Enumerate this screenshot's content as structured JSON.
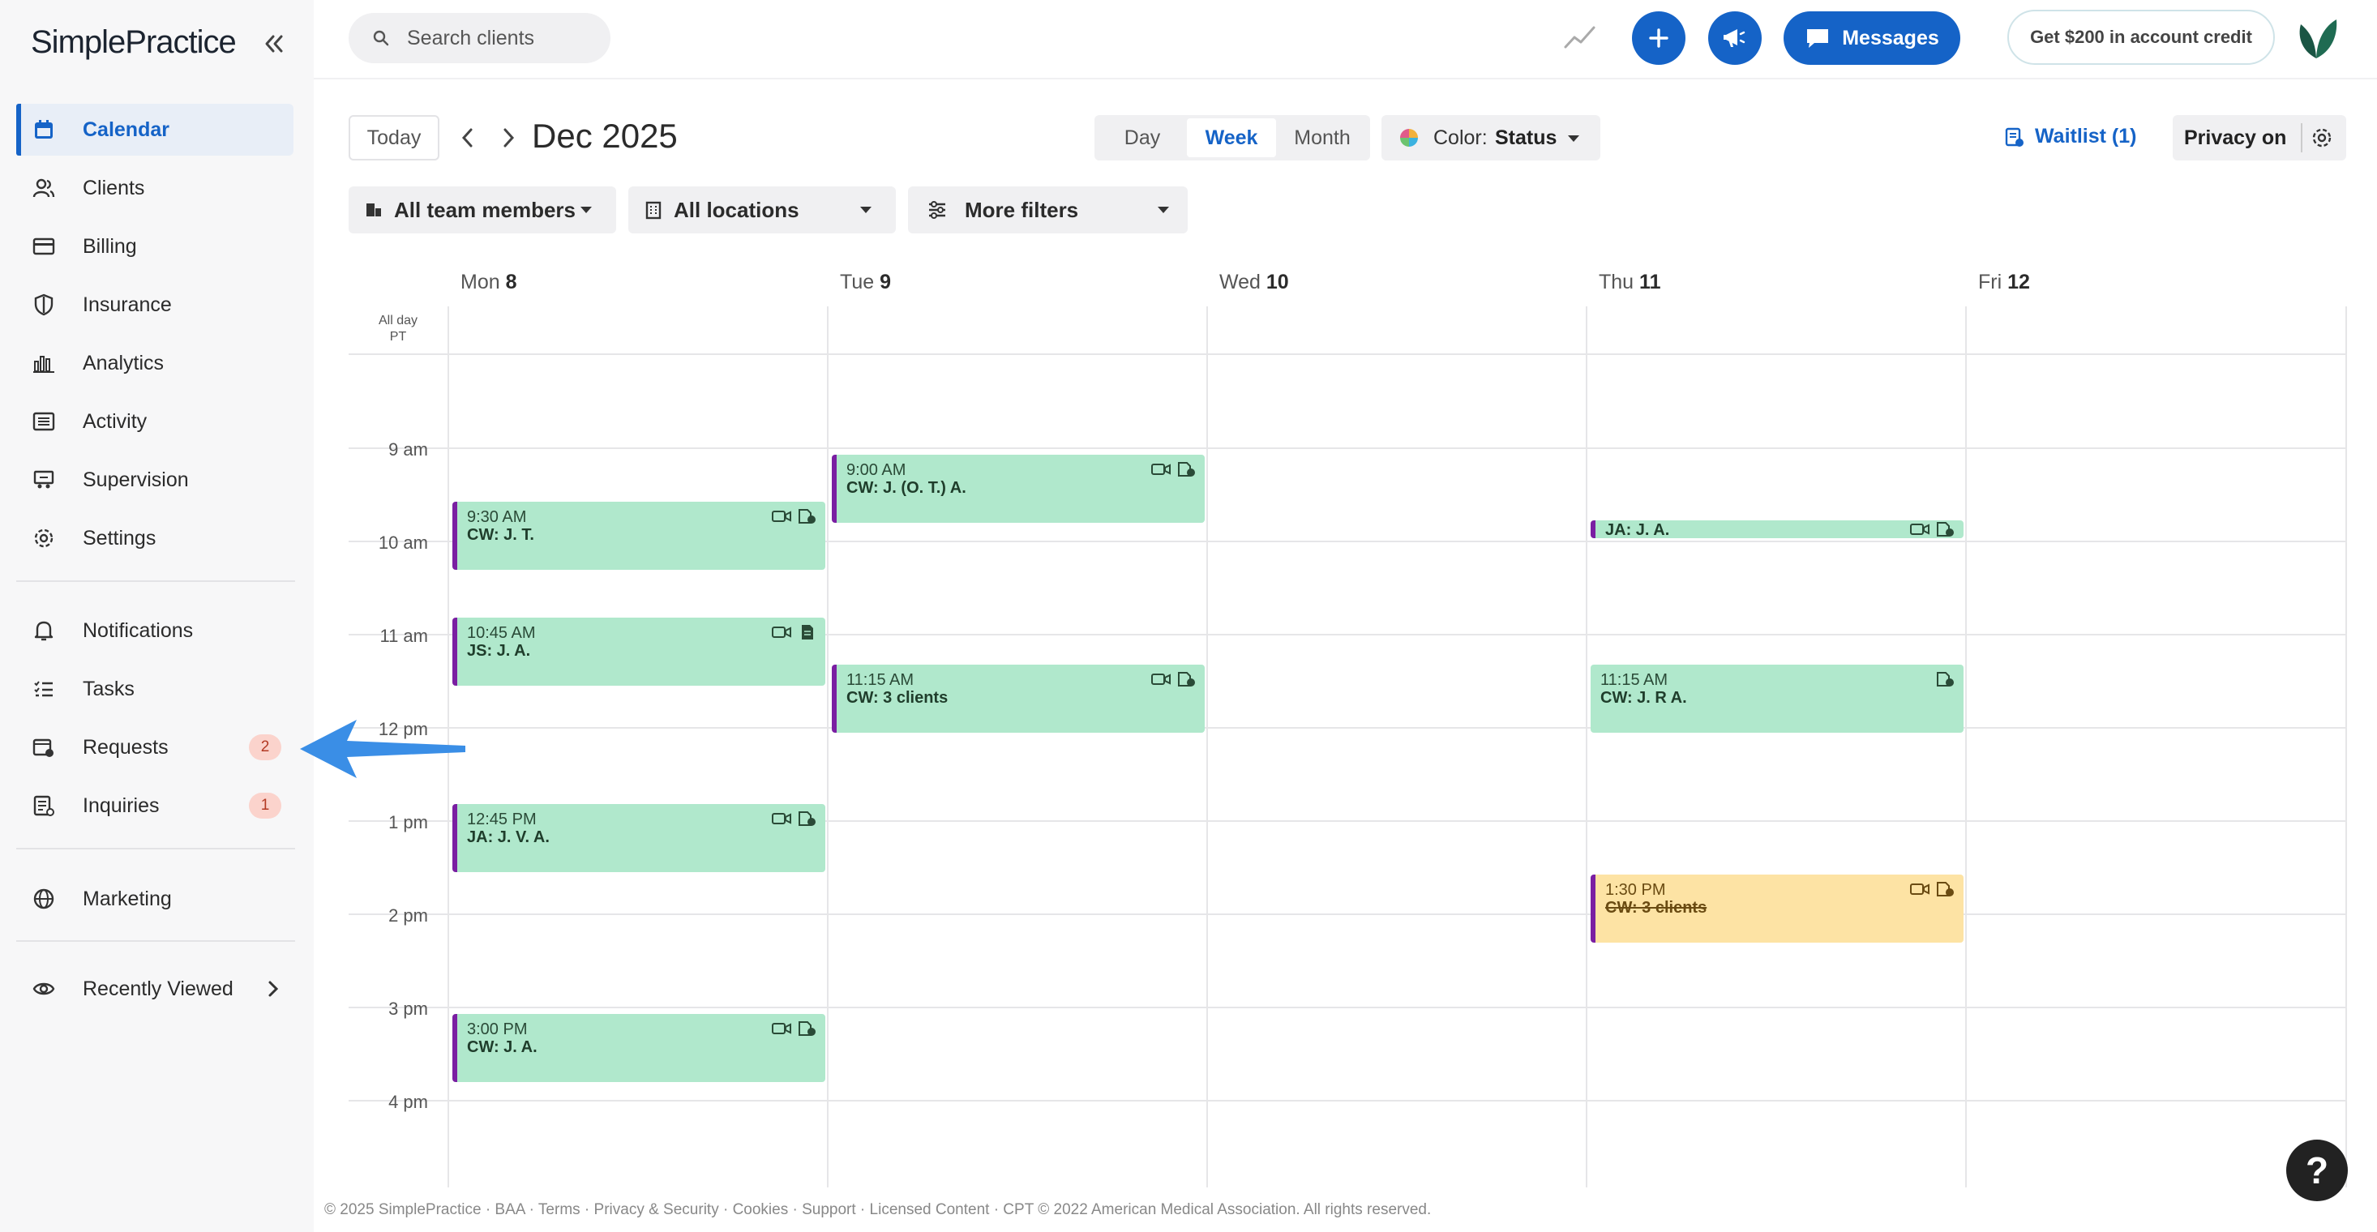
{
  "brand": {
    "name": "SimplePractice"
  },
  "sidebar": {
    "items": [
      {
        "label": "Calendar",
        "icon": "calendar-icon",
        "active": true
      },
      {
        "label": "Clients",
        "icon": "clients-icon"
      },
      {
        "label": "Billing",
        "icon": "billing-card-icon"
      },
      {
        "label": "Insurance",
        "icon": "shield-icon"
      },
      {
        "label": "Analytics",
        "icon": "bar-chart-icon"
      },
      {
        "label": "Activity",
        "icon": "activity-list-icon"
      },
      {
        "label": "Supervision",
        "icon": "supervision-icon"
      },
      {
        "label": "Settings",
        "icon": "gear-icon"
      },
      {
        "label": "Notifications",
        "icon": "bell-icon"
      },
      {
        "label": "Tasks",
        "icon": "tasks-icon"
      },
      {
        "label": "Requests",
        "icon": "requests-calendar-icon",
        "badge": "2"
      },
      {
        "label": "Inquiries",
        "icon": "inquiries-icon",
        "badge": "1"
      },
      {
        "label": "Marketing",
        "icon": "globe-icon"
      },
      {
        "label": "Recently Viewed",
        "icon": "eye-icon"
      }
    ]
  },
  "topbar": {
    "search_placeholder": "Search clients",
    "messages_label": "Messages",
    "credit_label": "Get $200 in account credit"
  },
  "toolbar": {
    "today_label": "Today",
    "month_title": "Dec 2025",
    "views": [
      "Day",
      "Week",
      "Month"
    ],
    "selected_view": "Week",
    "color_prefix": "Color:",
    "color_value": "Status",
    "waitlist_label": "Waitlist (1)",
    "privacy_label": "Privacy on"
  },
  "filters": {
    "team": "All team members",
    "locations": "All locations",
    "more": "More filters"
  },
  "calendar": {
    "allday_label": "All day",
    "tz_label": "PT",
    "days": [
      {
        "name": "Mon",
        "num": "8"
      },
      {
        "name": "Tue",
        "num": "9"
      },
      {
        "name": "Wed",
        "num": "10"
      },
      {
        "name": "Thu",
        "num": "11"
      },
      {
        "name": "Fri",
        "num": "12"
      }
    ],
    "times": [
      "9 am",
      "10 am",
      "11 am",
      "12 pm",
      "1 pm",
      "2 pm",
      "3 pm",
      "4 pm"
    ],
    "events": [
      {
        "day": 0,
        "time": "9:30 AM",
        "title": "CW: J. T.",
        "icons": [
          "video-icon",
          "client-portal-icon"
        ],
        "status": "green"
      },
      {
        "day": 0,
        "time": "10:45 AM",
        "title": "JS: J. A.",
        "icons": [
          "video-icon",
          "note-icon"
        ],
        "status": "green"
      },
      {
        "day": 0,
        "time": "12:45 PM",
        "title": "JA: J. V. A.",
        "icons": [
          "video-icon",
          "client-portal-icon"
        ],
        "status": "green"
      },
      {
        "day": 0,
        "time": "3:00 PM",
        "title": "CW: J. A.",
        "icons": [
          "video-icon",
          "client-portal-icon"
        ],
        "status": "green"
      },
      {
        "day": 1,
        "time": "9:00 AM",
        "title": "CW: J. (O. T.) A.",
        "icons": [
          "video-icon",
          "client-portal-icon"
        ],
        "status": "green"
      },
      {
        "day": 1,
        "time": "11:15 AM",
        "title": "CW: 3 clients",
        "icons": [
          "video-icon",
          "client-portal-icon"
        ],
        "status": "green"
      },
      {
        "day": 3,
        "time": "",
        "title": "JA: J. A.",
        "icons": [
          "video-icon",
          "client-portal-icon"
        ],
        "status": "green"
      },
      {
        "day": 3,
        "time": "11:15 AM",
        "title": "CW: J. R A.",
        "icons": [
          "client-portal-icon"
        ],
        "status": "green"
      },
      {
        "day": 3,
        "time": "1:30 PM",
        "title": "CW: 3 clients",
        "icons": [
          "video-icon",
          "client-portal-icon"
        ],
        "status": "cancelled-yellow"
      }
    ]
  },
  "footer": {
    "text": "© 2025 SimplePractice · BAA · Terms · Privacy & Security · Cookies · Support · Licensed Content · CPT © 2022 American Medical Association. All rights reserved."
  },
  "help_label": "?",
  "colors": {
    "brand_blue": "#1563c7",
    "event_green": "#b0e8cc",
    "event_yellow": "#fde3a4",
    "event_border_purple": "#7a1fa2",
    "annotation_arrow": "#3a8ee6"
  }
}
